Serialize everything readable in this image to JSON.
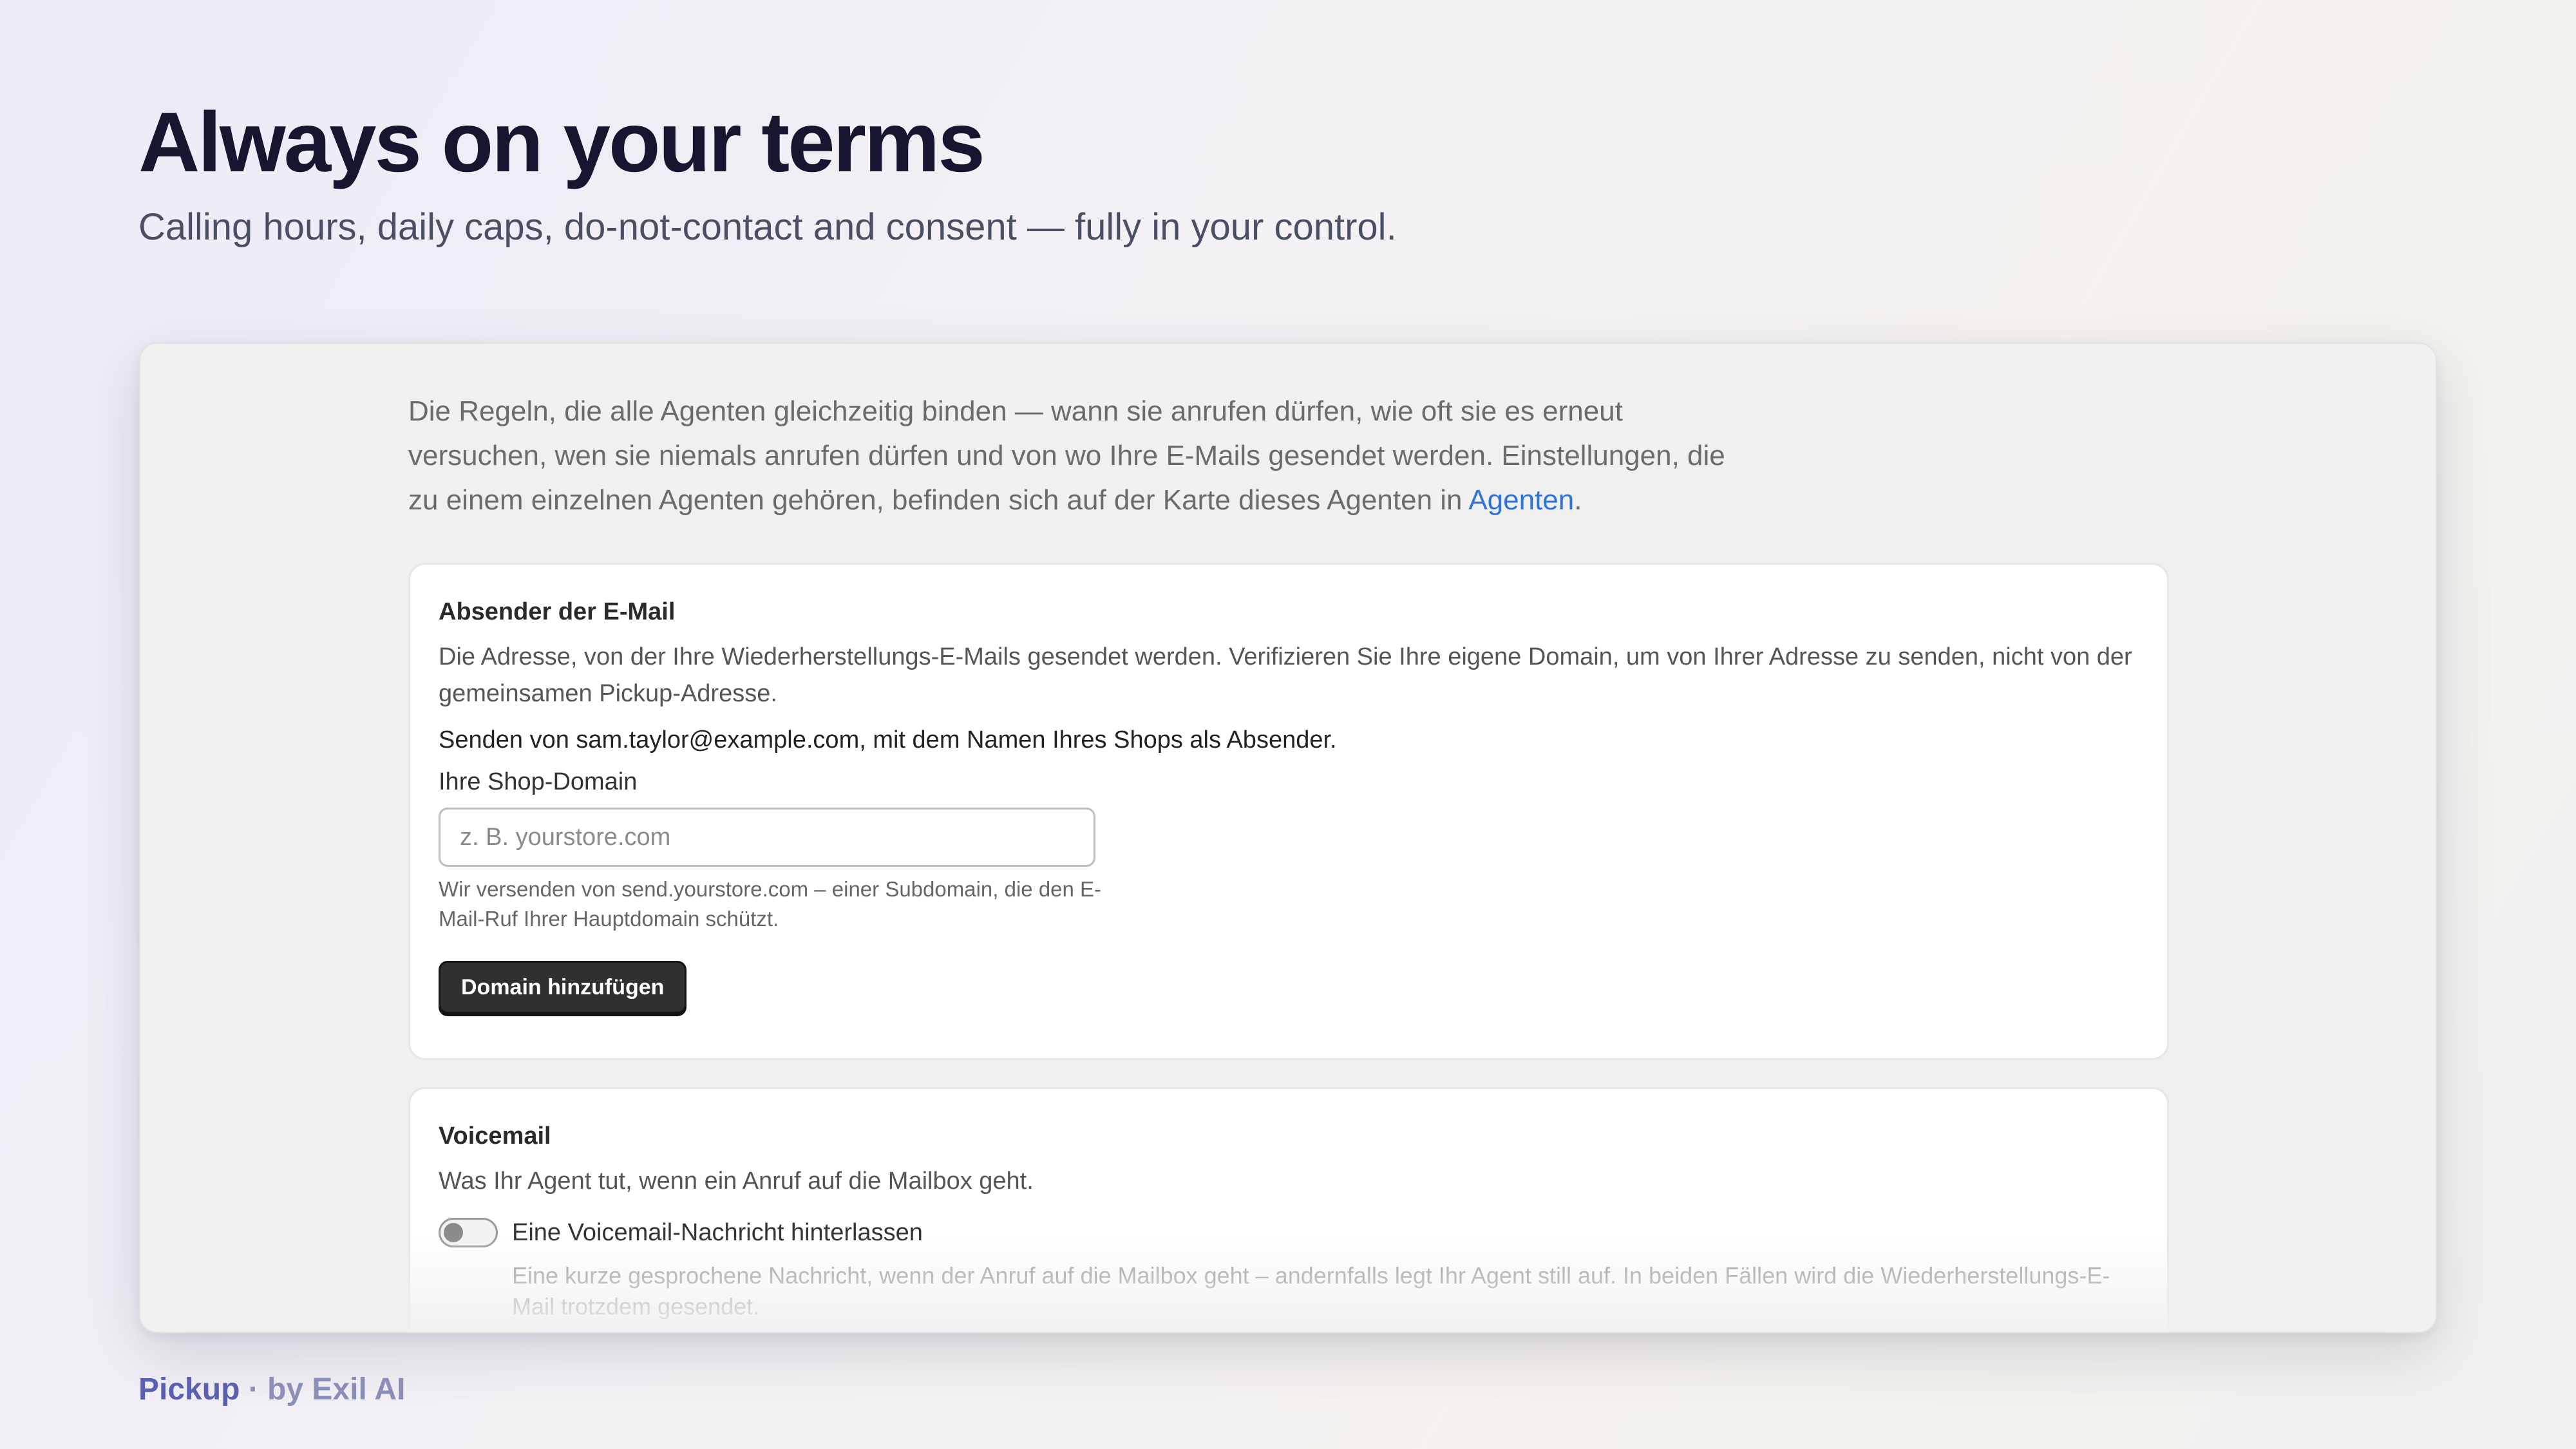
{
  "hero": {
    "title": "Always on your terms",
    "subtitle": "Calling hours, daily caps, do-not-contact and consent — fully in your control."
  },
  "intro": {
    "text": "Die Regeln, die alle Agenten gleichzeitig binden — wann sie anrufen dürfen, wie oft sie es erneut versuchen, wen sie niemals anrufen dürfen und von wo Ihre E-Mails gesendet werden. Einstellungen, die zu einem einzelnen Agenten gehören, befinden sich auf der Karte dieses Agenten in ",
    "link_label": "Agenten",
    "suffix": "."
  },
  "email_card": {
    "title": "Absender der E-Mail",
    "description": "Die Adresse, von der Ihre Wiederherstellungs-E-Mails gesendet werden. Verifizieren Sie Ihre eigene Domain, um von Ihrer Adresse zu senden, nicht von der gemeinsamen Pickup-Adresse.",
    "sender_line": "Senden von sam.taylor@example.com, mit dem Namen Ihres Shops als Absender.",
    "field_label": "Ihre Shop-Domain",
    "input_value": "",
    "input_placeholder": "z. B. yourstore.com",
    "helper": "Wir versenden von send.yourstore.com – einer Subdomain, die den E-Mail-Ruf Ihrer Hauptdomain schützt.",
    "button_label": "Domain hinzufügen"
  },
  "voicemail_card": {
    "title": "Voicemail",
    "description": "Was Ihr Agent tut, wenn ein Anruf auf die Mailbox geht.",
    "toggle_label": "Eine Voicemail-Nachricht hinterlassen",
    "toggle_on": false,
    "toggle_help": "Eine kurze gesprochene Nachricht, wenn der Anruf auf die Mailbox geht – andernfalls legt Ihr Agent still auf. In beiden Fällen wird die Wiederherstellungs-E-Mail trotzdem gesendet."
  },
  "footer": {
    "brand": "Pickup",
    "tagline": " · by Exil AI"
  }
}
